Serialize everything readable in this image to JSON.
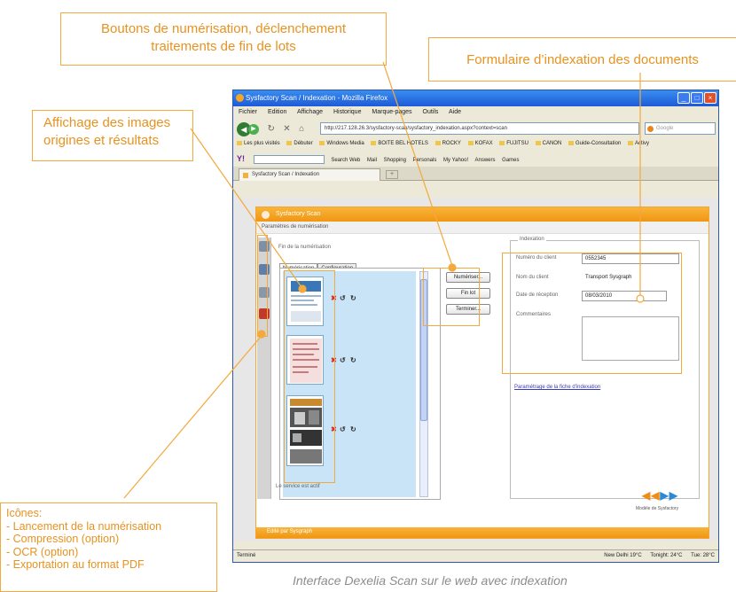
{
  "callouts": {
    "buttons": [
      "Boutons de numérisation, déclenchement",
      "traitements de fin de lots"
    ],
    "form": "Formulaire d’indexation des documents",
    "images": [
      "Affichage des images",
      "origines et résultats"
    ],
    "icons_title": "Icônes:",
    "icons_items": [
      "- Lancement de la numérisation",
      "- Compression (option)",
      "- OCR (option)",
      "- Exportation au format PDF"
    ]
  },
  "caption": "Interface Dexelia Scan sur le web avec indexation",
  "browser": {
    "title": "Sysfactory Scan / Indexation - Mozilla Firefox",
    "menu": [
      "Fichier",
      "Edition",
      "Affichage",
      "Historique",
      "Marque-pages",
      "Outils",
      "Aide"
    ],
    "url": "http://217.128.26.3/sysfactory-scan/sysfactory_indexation.aspx?context=scan",
    "search_placeholder": "Google",
    "bookmarks": [
      "Les plus visités",
      "Débuter",
      "Windows Media",
      "BOITE BEL HOTELS",
      "ROCKY",
      "KOFAX",
      "FUJITSU",
      "CANON",
      "Guide-Consultation",
      "Activy"
    ],
    "toolbar": {
      "logo": "Y!",
      "items": [
        "Search Web",
        "Mail",
        "Shopping",
        "Personals",
        "My Yahoo!",
        "Answers",
        "Games"
      ]
    },
    "tab": "Sysfactory Scan / Indexation",
    "tab_new": "+",
    "status_left": "Terminé",
    "status_right": [
      "New Delhi 19°C",
      "Tonight: 24°C",
      "Tue: 28°C"
    ]
  },
  "app": {
    "header": "Sysfactory Scan",
    "subheader": "Paramètres de numérisation",
    "file_label": "Fin de la numérisation",
    "tabs": [
      "Numérisation",
      "Configuration"
    ],
    "buttons": [
      "Numériser...",
      "Fin lot",
      "Terminer..."
    ],
    "form": {
      "legend": "Indexation",
      "client_number_label": "Numéro du client",
      "client_number": "0552345",
      "client_name_label": "Nom du client",
      "client_name": "Transport Sysgraph",
      "reception_date_label": "Date de réception",
      "reception_date": "08/03/2010",
      "comments_label": "Commentaires",
      "link": "Paramétrage de la fiche d'indexation"
    },
    "status": "Le service est actif",
    "logo_sub": "Modèle de Sysfactory",
    "footer": "Edité par Sysgraph"
  },
  "colors": {
    "accent": "#f3a93c",
    "callout_text": "#e8921f",
    "app_orange": "#f09612",
    "thumb_bg": "#c9e4f6"
  }
}
